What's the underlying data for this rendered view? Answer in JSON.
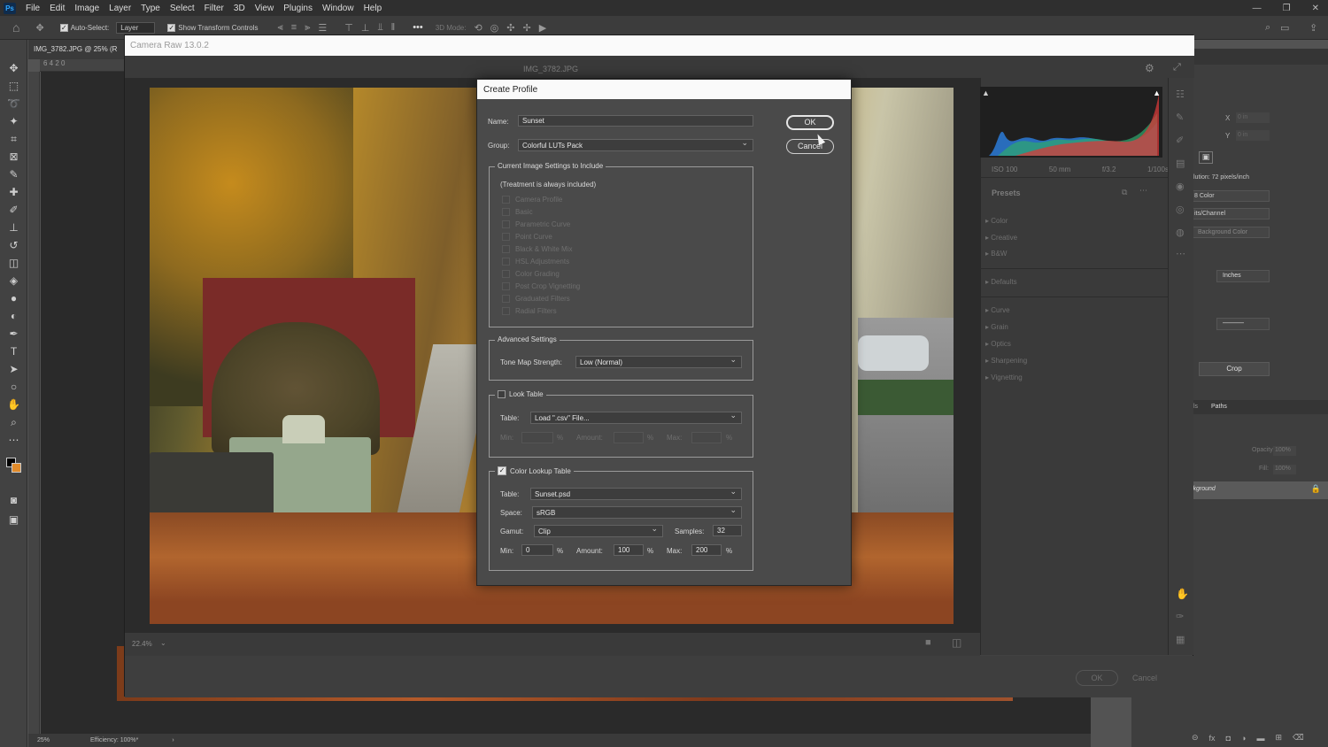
{
  "app": {
    "logo": "Ps",
    "menu": [
      "File",
      "Edit",
      "Image",
      "Layer",
      "Type",
      "Select",
      "Filter",
      "3D",
      "View",
      "Plugins",
      "Window",
      "Help"
    ]
  },
  "options_bar": {
    "auto_select_label": "Auto-Select:",
    "auto_select_target": "Layer",
    "show_transform_label": "Show Transform Controls",
    "mode_3d_label": "3D Mode:"
  },
  "document": {
    "tab_title": "IMG_3782.JPG @ 25% (R",
    "ruler_top": "6  4  2  0",
    "status_zoom": "25%",
    "status_efficiency": "Efficiency: 100%*"
  },
  "camera_raw": {
    "window_title": "Camera Raw 13.0.2",
    "filename": "IMG_3782.JPG",
    "zoom": "22.4%",
    "exif": [
      "ISO 100",
      "50 mm",
      "f/3.2",
      "1/100s"
    ],
    "presets_title": "Presets",
    "preset_groups": [
      "Color",
      "Creative",
      "B&W",
      "Defaults",
      "Curve",
      "Grain",
      "Optics",
      "Sharpening",
      "Vignetting"
    ],
    "ok_label": "OK",
    "cancel_label": "Cancel"
  },
  "ps_right_panel": {
    "x_label": "X",
    "y_label": "Y",
    "x_value": "0 in",
    "y_value": "0 in",
    "resolution": "lution: 72 pixels/inch",
    "mode": "8 Color",
    "bits": "its/Channel",
    "bg_color": "Background Color",
    "units": "Inches",
    "crop_button": "Crop",
    "tabs": [
      "ls",
      "Paths"
    ],
    "opacity_label": "Opacity:",
    "opacity_value": "100%",
    "fill_label": "Fill:",
    "fill_value": "100%",
    "layer_name": "ckground"
  },
  "dialog": {
    "title": "Create Profile",
    "name_label": "Name:",
    "name_value": "Sunset",
    "group_label": "Group:",
    "group_value": "Colorful LUTs Pack",
    "ok_label": "OK",
    "cancel_label": "Cancel",
    "current_settings_title": "Current Image Settings to Include",
    "treatment_note": "(Treatment is always included)",
    "settings": [
      "Camera Profile",
      "Basic",
      "Parametric Curve",
      "Point Curve",
      "Black & White Mix",
      "HSL Adjustments",
      "Color Grading",
      "Post Crop Vignetting",
      "Graduated Filters",
      "Radial Filters"
    ],
    "advanced_title": "Advanced Settings",
    "tone_map_label": "Tone Map Strength:",
    "tone_map_value": "Low (Normal)",
    "look_table_title": "Look Table",
    "look_table_label": "Table:",
    "look_table_value": "Load \".csv\" File...",
    "look_min_label": "Min:",
    "look_amount_label": "Amount:",
    "look_max_label": "Max:",
    "percent": "%",
    "clut_title": "Color Lookup Table",
    "clut_table_label": "Table:",
    "clut_table_value": "Sunset.psd",
    "clut_space_label": "Space:",
    "clut_space_value": "sRGB",
    "clut_gamut_label": "Gamut:",
    "clut_gamut_value": "Clip",
    "clut_samples_label": "Samples:",
    "clut_samples_value": "32",
    "clut_min_label": "Min:",
    "clut_min_value": "0",
    "clut_amount_label": "Amount:",
    "clut_amount_value": "100",
    "clut_max_label": "Max:",
    "clut_max_value": "200"
  }
}
